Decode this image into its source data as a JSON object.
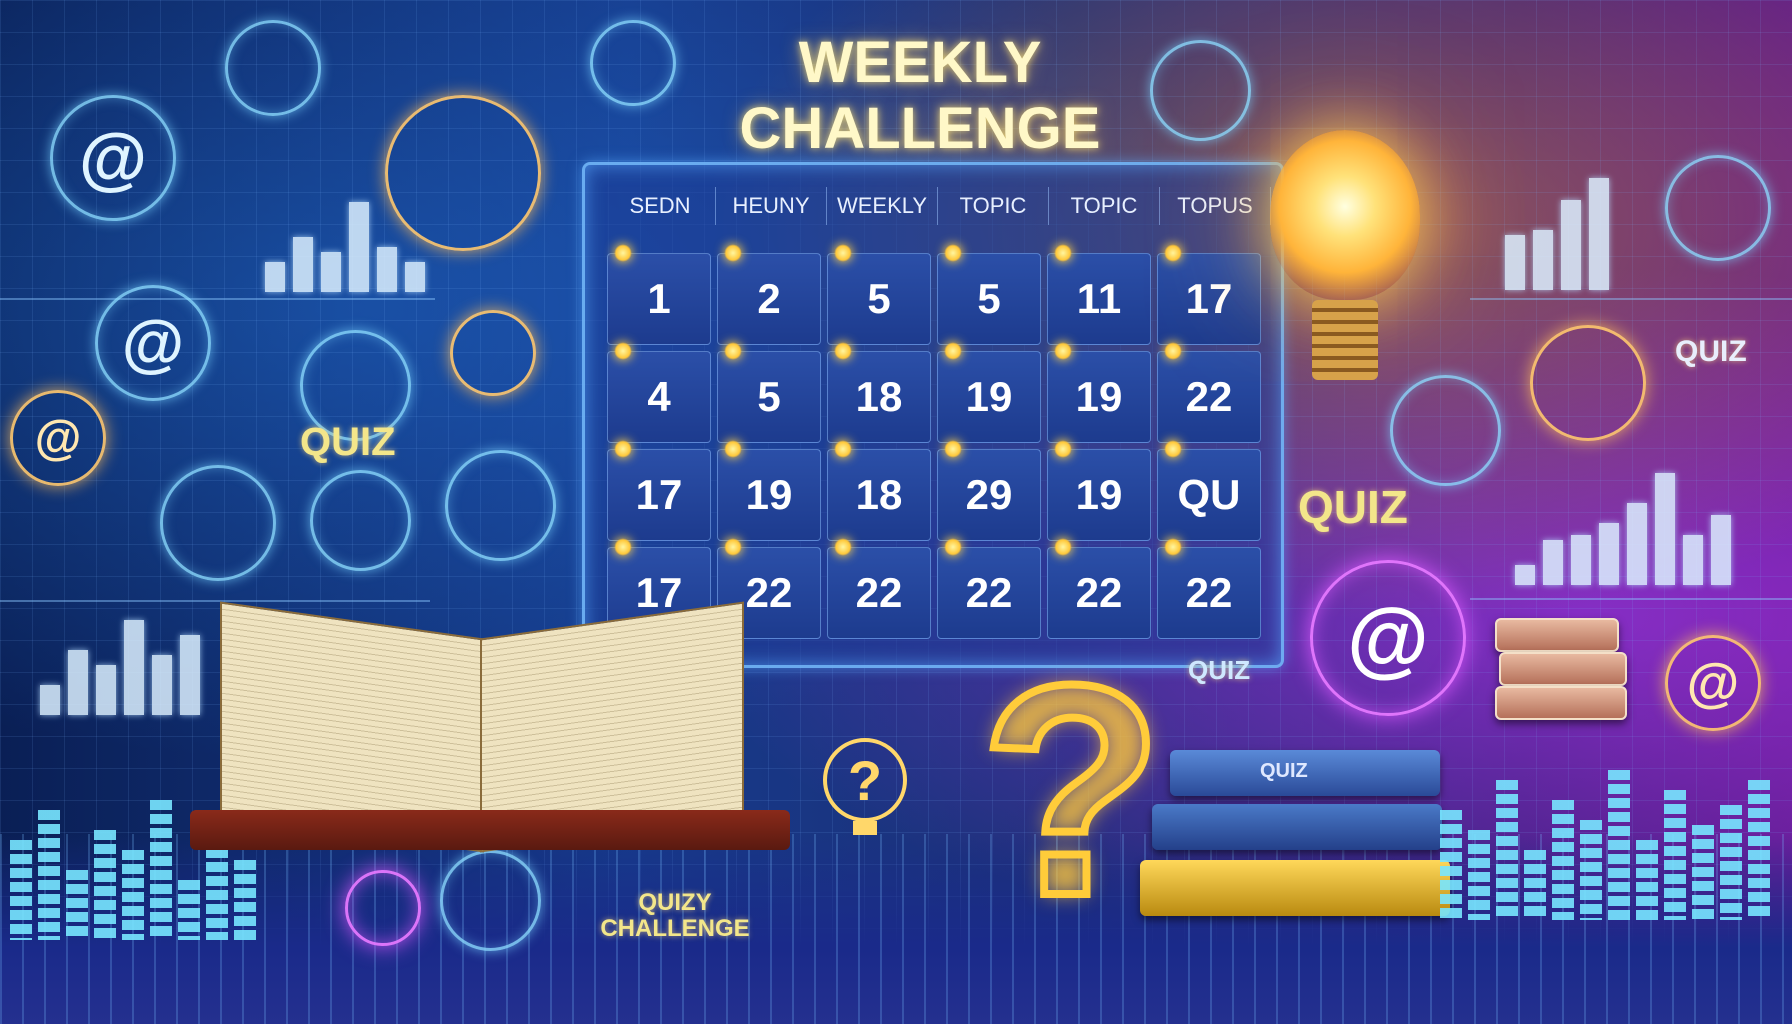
{
  "title": {
    "line1": "WEEKLY",
    "line2": "CHALLENGE"
  },
  "calendar": {
    "headers": [
      "SEDN",
      "HEUNY",
      "WEEKLY",
      "TOPIC",
      "TOPIC",
      "TOPUS"
    ],
    "rows": [
      [
        "1",
        "2",
        "5",
        "5",
        "11",
        "17"
      ],
      [
        "4",
        "5",
        "18",
        "19",
        "19",
        "22"
      ],
      [
        "17",
        "19",
        "18",
        "29",
        "19",
        "QU"
      ],
      [
        "17",
        "22",
        "22",
        "22",
        "22",
        "22"
      ]
    ]
  },
  "labels": {
    "quiz_left": "QUIZ",
    "quiz_right": "QUIZ",
    "quiz_far_right": "QUIZ",
    "quiz_small": "QUIZ",
    "book_quiz": "QUIZ",
    "bottom_line1": "QUIZY",
    "bottom_line2": "CHALLENGE"
  },
  "icons": {
    "at_symbol": "@",
    "question_mark": "?"
  },
  "colors": {
    "title": "#fff8c8",
    "calendar_border": "#78beff",
    "glow_gold": "#ffcc3a",
    "neon_purple": "#dc5aff"
  }
}
